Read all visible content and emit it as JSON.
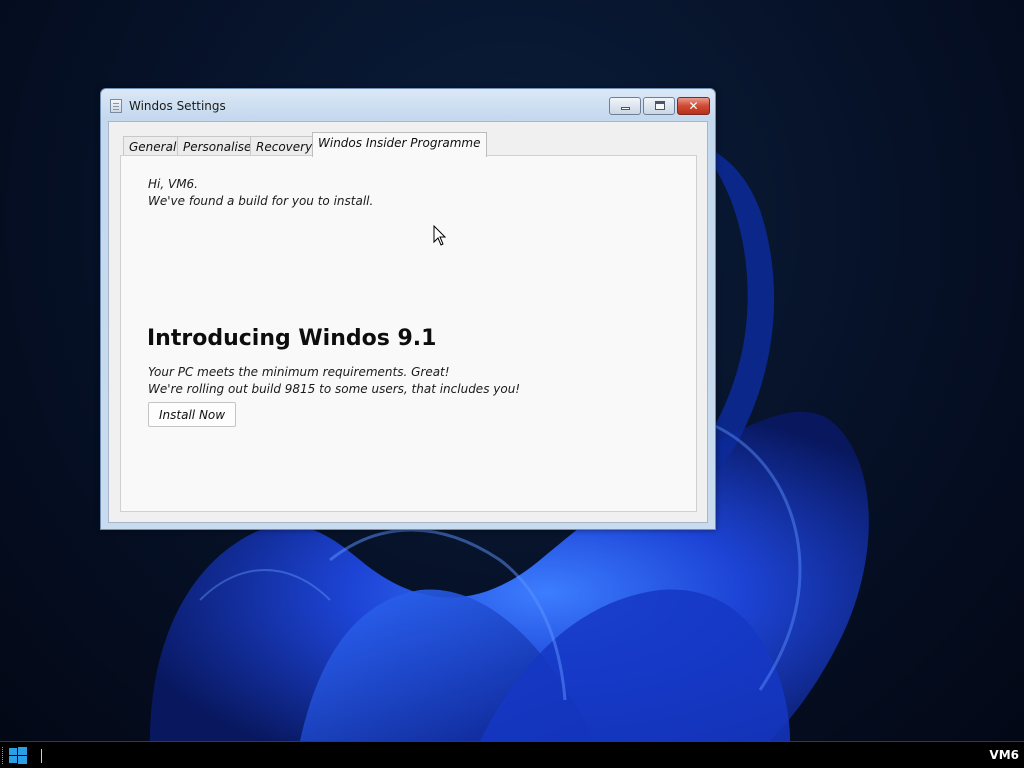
{
  "window": {
    "title": "Windos Settings",
    "close_glyph": "✕"
  },
  "tabs": [
    {
      "label": "General",
      "active": false
    },
    {
      "label": "Personalise",
      "active": false
    },
    {
      "label": "Recovery",
      "active": false
    },
    {
      "label": "Windos Insider Programme",
      "active": true
    }
  ],
  "insider": {
    "greeting": "Hi, VM6.",
    "subgreeting": "We've found a build for you to install.",
    "headline": "Introducing Windos 9.1",
    "requirements_line1": "Your PC meets the minimum requirements. Great!",
    "requirements_line2": "We're rolling out build 9815 to some users, that includes you!",
    "install_button_label": "Install Now"
  },
  "taskbar": {
    "user_label": "VM6"
  },
  "icons": {
    "app": "settings-app-icon",
    "start": "windows-logo-icon",
    "cursor": "mouse-pointer-icon"
  },
  "colors": {
    "desktop_bg": "#061127",
    "bloom_blue": "#1f4fe0",
    "close_red": "#cf4a33",
    "start_blue": "#2a9fe6"
  }
}
